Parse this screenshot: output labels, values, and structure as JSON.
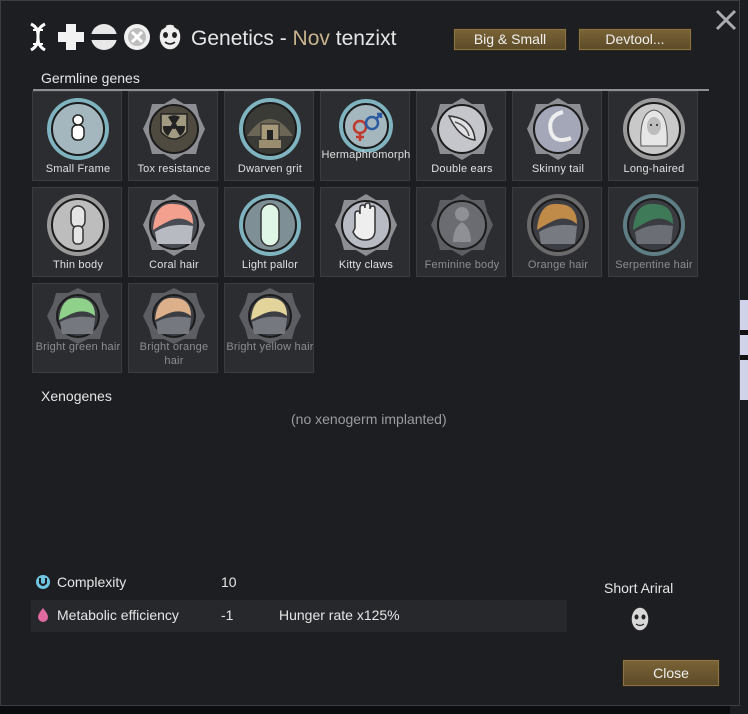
{
  "window": {
    "title_prefix": "Genetics - ",
    "xenotype_name": "Nov",
    "pawn_name": " tenzixt",
    "buttons": {
      "big_small": "Big & Small",
      "devtool": "Devtool...",
      "close": "Close"
    },
    "header_icons": [
      "dna-icon",
      "cross-icon",
      "pill-icon",
      "x-circle-icon",
      "face-mask-icon"
    ]
  },
  "germline": {
    "label": "Germline genes",
    "genes": [
      {
        "name": "Small Frame",
        "icon": "small-frame-icon",
        "active": true
      },
      {
        "name": "Tox resistance",
        "icon": "tox-resistance-icon",
        "active": true
      },
      {
        "name": "Dwarven grit",
        "icon": "dwarven-grit-icon",
        "active": true
      },
      {
        "name": "Hermaphromorph",
        "icon": "hermaphromorph-icon",
        "active": true
      },
      {
        "name": "Double ears",
        "icon": "double-ears-icon",
        "active": true
      },
      {
        "name": "Skinny tail",
        "icon": "skinny-tail-icon",
        "active": true
      },
      {
        "name": "Long-haired",
        "icon": "long-haired-icon",
        "active": true
      },
      {
        "name": "Thin body",
        "icon": "thin-body-icon",
        "active": true
      },
      {
        "name": "Coral hair",
        "icon": "coral-hair-icon",
        "active": true
      },
      {
        "name": "Light pallor",
        "icon": "light-pallor-icon",
        "active": true
      },
      {
        "name": "Kitty claws",
        "icon": "kitty-claws-icon",
        "active": true
      },
      {
        "name": "Feminine body",
        "icon": "feminine-body-icon",
        "active": false
      },
      {
        "name": "Orange hair",
        "icon": "orange-hair-icon",
        "active": false
      },
      {
        "name": "Serpentine hair",
        "icon": "serpentine-hair-icon",
        "active": false
      },
      {
        "name": "Bright green hair",
        "icon": "bright-green-hair-icon",
        "active": false
      },
      {
        "name": "Bright orange hair",
        "icon": "bright-orange-hair-icon",
        "active": false
      },
      {
        "name": "Bright yellow hair",
        "icon": "bright-yellow-hair-icon",
        "active": false
      }
    ]
  },
  "xenogenes": {
    "label": "Xenogenes",
    "empty_text": "(no xenogerm implanted)"
  },
  "stats": [
    {
      "name": "Complexity",
      "value": "10",
      "note": "",
      "icon": "complexity-icon",
      "color": "#6ec6e0"
    },
    {
      "name": "Metabolic efficiency",
      "value": "-1",
      "note": "Hunger rate x125%",
      "icon": "metabolism-icon",
      "color": "#e06aa0"
    }
  ],
  "endogene": {
    "name": "Short Ariral",
    "icon": "xenotype-face-icon"
  },
  "colors": {
    "window_bg": "#1c1e22",
    "gene_bg": "#2b2d31",
    "button_gold": "#7a6437",
    "xenotype_name": "#c8b48c"
  }
}
